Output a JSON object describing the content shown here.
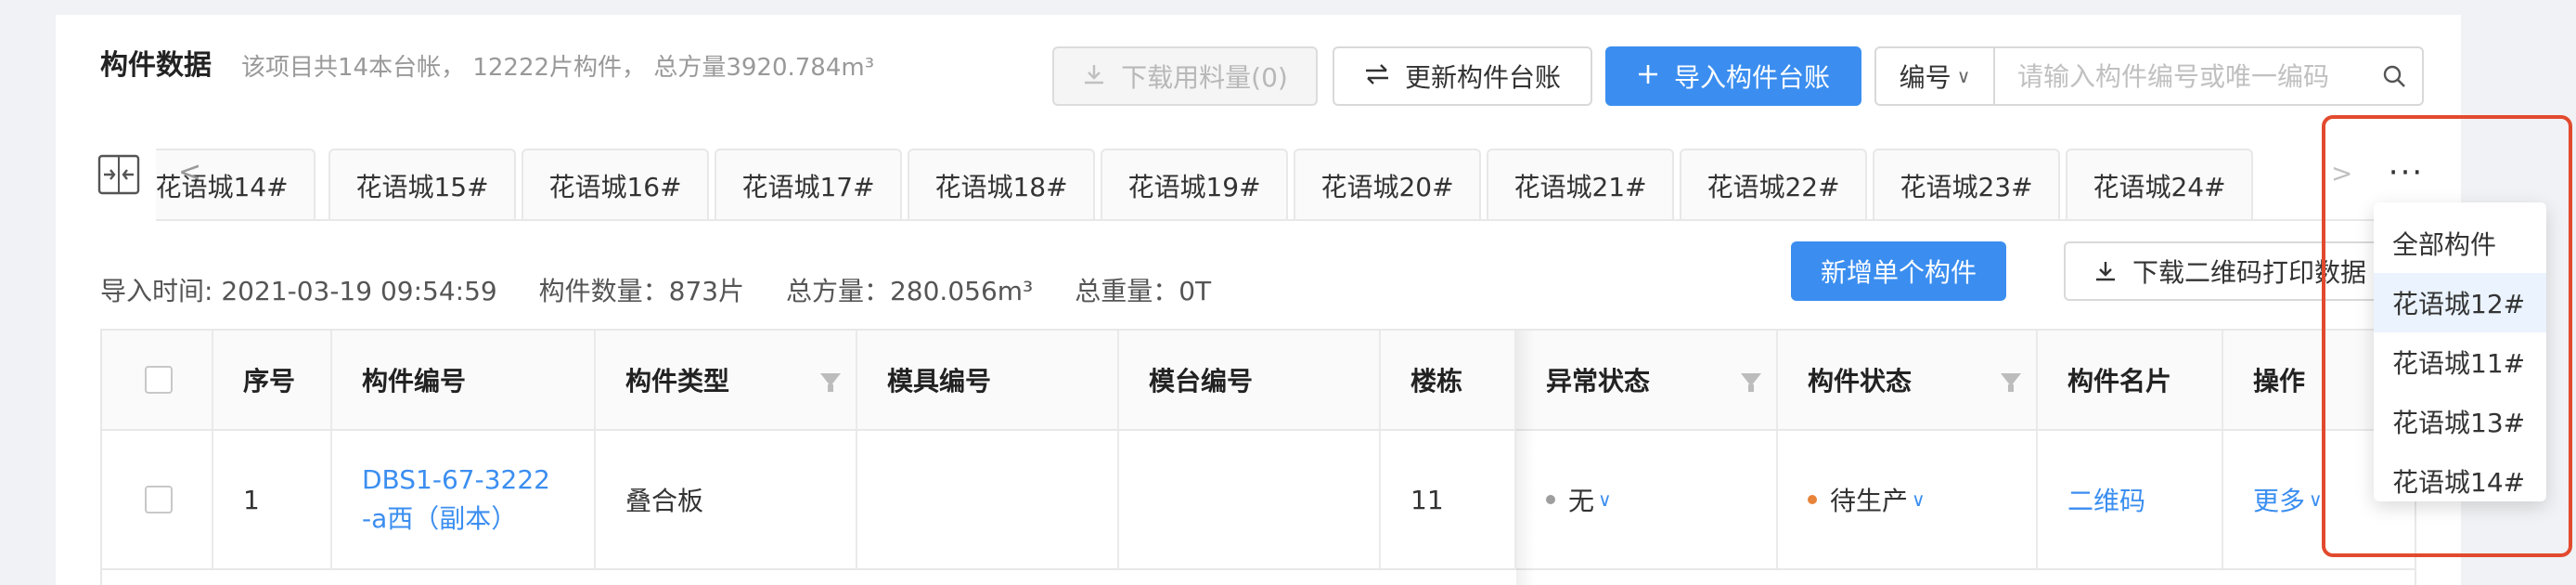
{
  "header": {
    "title": "构件数据",
    "summary": "该项目共14本台帐， 12222片构件， 总方量3920.784m³",
    "download_usage": "下载用料量(0)",
    "update_ledger": "更新构件台账",
    "import_ledger": "导入构件台账",
    "search_select": "编号",
    "search_placeholder": "请输入构件编号或唯一编码"
  },
  "tabs": {
    "scroll_left": "<",
    "scroll_right": ">",
    "more": "···",
    "items": [
      "花语城14#",
      "花语城15#",
      "花语城16#",
      "花语城17#",
      "花语城18#",
      "花语城19#",
      "花语城20#",
      "花语城21#",
      "花语城22#",
      "花语城23#",
      "花语城24#"
    ]
  },
  "info": {
    "import_time": "导入时间: 2021-03-19 09:54:59",
    "count": "构件数量：873片",
    "volume": "总方量：280.056m³",
    "weight": "总重量：0T",
    "add_single": "新增单个构件",
    "download_qr": "下载二维码打印数据"
  },
  "table": {
    "columns": [
      "序号",
      "构件编号",
      "构件类型",
      "模具编号",
      "模台编号",
      "楼栋",
      "异常状态",
      "构件状态",
      "构件名片",
      "操作"
    ],
    "rows": [
      {
        "index": "1",
        "code_line1": "DBS1-67-3222",
        "code_line2": "-a西（副本）",
        "type": "叠合板",
        "mold": "",
        "platform": "",
        "building": "11",
        "exception": "无",
        "status": "待生产",
        "card": "二维码",
        "action": "更多"
      }
    ]
  },
  "dropdown": {
    "items": [
      "全部构件",
      "花语城12#",
      "花语城11#",
      "花语城13#",
      "花语城14#"
    ],
    "selected": "花语城12#"
  },
  "colors": {
    "primary": "#3b8ef0",
    "exception_dot": "#9e9e9e",
    "pending_dot": "#e8843a",
    "highlight": "#e24a2e"
  }
}
